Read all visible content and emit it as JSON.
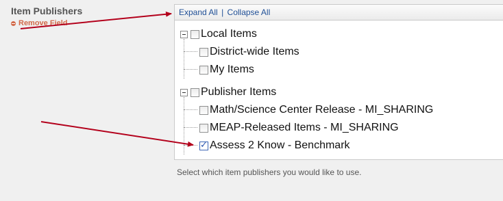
{
  "field": {
    "title": "Item Publishers",
    "remove_label": "Remove Field"
  },
  "tree_header": {
    "expand_label": "Expand All",
    "separator": "|",
    "collapse_label": "Collapse All"
  },
  "tree": {
    "local": {
      "label": "Local Items",
      "checked": false,
      "children": [
        {
          "label": "District-wide Items",
          "checked": false
        },
        {
          "label": "My Items",
          "checked": false
        }
      ]
    },
    "publisher": {
      "label": "Publisher Items",
      "checked": false,
      "children": [
        {
          "label": "Math/Science Center Release - MI_SHARING",
          "checked": false
        },
        {
          "label": "MEAP-Released Items - MI_SHARING",
          "checked": false
        },
        {
          "label": "Assess 2 Know - Benchmark",
          "checked": true
        }
      ]
    }
  },
  "hint": "Select which item publishers you would like to use.",
  "colors": {
    "arrow": "#b3001b",
    "link": "#1f4f96",
    "remove": "#d26a4a"
  }
}
